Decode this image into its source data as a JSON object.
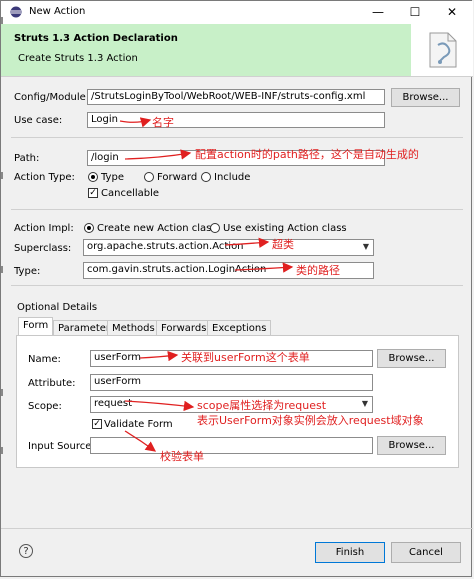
{
  "window": {
    "title": "New Action",
    "controls": {
      "minimize": "—",
      "maximize": "☐",
      "close": "✕"
    }
  },
  "banner": {
    "heading": "Struts 1.3 Action Declaration",
    "subheading": "Create Struts 1.3 Action"
  },
  "config": {
    "label": "Config/Module:",
    "value": "/StrutsLoginByTool/WebRoot/WEB-INF/struts-config.xml",
    "browse": "Browse..."
  },
  "use_case": {
    "label": "Use case:",
    "value": "Login"
  },
  "path": {
    "label": "Path:",
    "value": "/login"
  },
  "action_type": {
    "label": "Action Type:",
    "options": [
      "Type",
      "Forward",
      "Include"
    ],
    "selected": "Type"
  },
  "cancellable": {
    "label": "Cancellable",
    "checked": true
  },
  "action_impl": {
    "label": "Action Impl:",
    "options": [
      "Create new Action class",
      "Use existing Action class"
    ],
    "selected": "Create new Action class"
  },
  "superclass": {
    "label": "Superclass:",
    "value": "org.apache.struts.action.Action"
  },
  "type": {
    "label": "Type:",
    "value": "com.gavin.struts.action.LoginAction"
  },
  "optional": {
    "label": "Optional Details",
    "tabs": [
      "Form",
      "Parameter",
      "Methods",
      "Forwards",
      "Exceptions"
    ],
    "active_tab": "Form",
    "name": {
      "label": "Name:",
      "value": "userForm",
      "browse": "Browse..."
    },
    "attribute": {
      "label": "Attribute:",
      "value": "userForm"
    },
    "scope": {
      "label": "Scope:",
      "value": "request"
    },
    "validate": {
      "label": "Validate Form",
      "checked": true
    },
    "input_source": {
      "label": "Input Source:",
      "value": "",
      "browse": "Browse..."
    }
  },
  "footer": {
    "help": "?",
    "finish": "Finish",
    "cancel": "Cancel"
  },
  "annotations": {
    "use_case": "名字",
    "path": "配置action时的path路径，这个是自动生成的",
    "superclass": "超类",
    "type": "类的路径",
    "name": "关联到userForm这个表单",
    "scope_1": "scope属性选择为request",
    "scope_2": "表示UserForm对象实例会放入request域对象",
    "validate": "校验表单"
  },
  "colors": {
    "banner": "#c8f0c8",
    "annotation": "#e02020",
    "default_button_border": "#0078d7"
  }
}
